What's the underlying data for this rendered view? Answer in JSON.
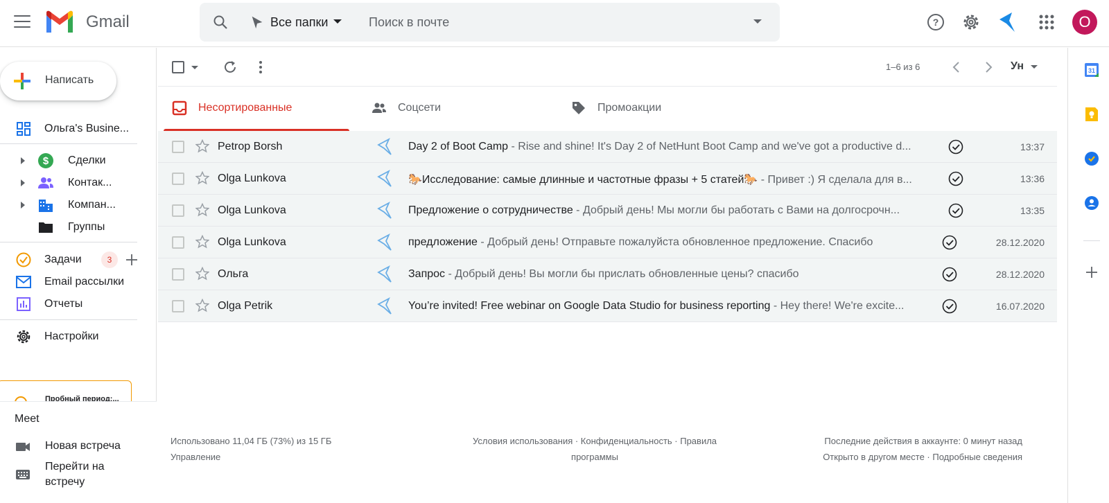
{
  "header": {
    "app_name": "Gmail",
    "folder_selector": "Все папки",
    "search_placeholder": "Поиск в почте",
    "avatar_letter": "O"
  },
  "sidebar": {
    "compose_label": "Написать",
    "business_label": "Ольга's Busine...",
    "sub_items": [
      {
        "label": "Сделки"
      },
      {
        "label": "Контак..."
      },
      {
        "label": "Компан..."
      },
      {
        "label": "Группы"
      }
    ],
    "tasks_label": "Задачи",
    "tasks_count": "3",
    "mailing_label": "Email рассылки",
    "reports_label": "Отчеты",
    "settings_label": "Настройки",
    "trial_label": "Пробный период:...",
    "meet": {
      "title": "Meet",
      "new_meeting": "Новая встреча",
      "join_meeting": "Перейти на встречу"
    }
  },
  "toolbar": {
    "pager": "1–6 из 6",
    "lang_label": "Ун"
  },
  "tabs": [
    {
      "label": "Несортированные",
      "active": true
    },
    {
      "label": "Соцсети",
      "active": false
    },
    {
      "label": "Промоакции",
      "active": false
    }
  ],
  "emails": [
    {
      "sender": "Petrop Borsh",
      "subject": "Day 2 of Boot Camp",
      "snippet": " - Rise and shine! It's Day 2 of NetHunt Boot Camp and we've got a productive d...",
      "date": "13:37"
    },
    {
      "sender": "Olga Lunkova",
      "subject": "🐎Исследование: самые длинные и частотные фразы + 5 статей🐎",
      "snippet": " - Привет :) Я сделала для в...",
      "date": "13:36"
    },
    {
      "sender": "Olga Lunkova",
      "subject": "Предложение о сотрудничестве",
      "snippet": " - Добрый день! Мы могли бы работать с Вами на долгосрочн...",
      "date": "13:35"
    },
    {
      "sender": "Olga Lunkova",
      "subject": "предложение",
      "snippet": " - Добрый день! Отправьте пожалуйста обновленное предложение. Спасибо",
      "date": "28.12.2020"
    },
    {
      "sender": "Ольга",
      "subject": "Запрос",
      "snippet": " - Добрый день! Вы могли бы прислать обновленные цены? спасибо",
      "date": "28.12.2020"
    },
    {
      "sender": "Olga Petrik",
      "subject": "You’re invited! Free webinar on Google Data Studio for business reporting",
      "snippet": " - Hey there! We're excite...",
      "date": "16.07.2020"
    }
  ],
  "footer": {
    "storage": "Использовано 11,04 ГБ (73%) из 15 ГБ",
    "manage": "Управление",
    "terms_line1": "Условия использования · Конфиденциальность · Правила",
    "terms_line2": "программы",
    "activity": "Последние действия в аккаунте: 0 минут назад",
    "opened": "Открыто в другом месте · Подробные сведения"
  },
  "colors": {
    "accent_red": "#d93025",
    "nethunt_blue": "#1a8ae5",
    "avatar": "#c2185b"
  }
}
